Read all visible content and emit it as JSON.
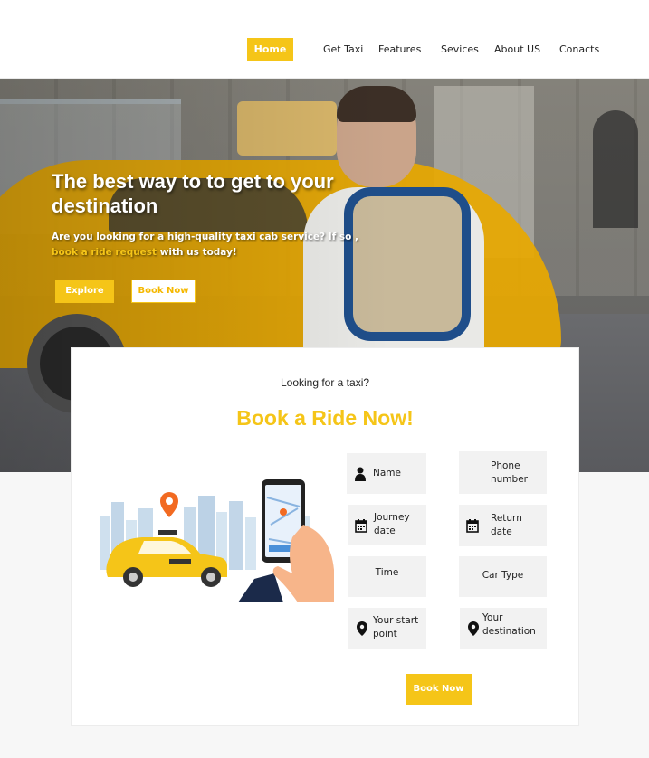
{
  "nav": {
    "items": [
      {
        "label": "Home",
        "active": true
      },
      {
        "label": "Get Taxi"
      },
      {
        "label": "Features"
      },
      {
        "label": "Sevices"
      },
      {
        "label": "About US"
      },
      {
        "label": "Conacts"
      }
    ]
  },
  "hero": {
    "title": "The best way to to get to your destination",
    "subtitle_part1": "Are you looking for a high-quality taxi cab service? If so ,",
    "subtitle_highlight": "book a ride request",
    "subtitle_part2": " with us today!",
    "explore_label": "Explore",
    "book_label": "Book Now"
  },
  "booking": {
    "kicker": "Looking for a taxi?",
    "title": "Book a Ride Now!",
    "fields": {
      "name": "Name",
      "phone": "Phone number",
      "journey_date": "Journey date",
      "return_date": "Return date",
      "time": "Time",
      "car_type": "Car Type",
      "start_point": "Your start point",
      "destination": "Your destination"
    },
    "submit_label": "Book Now"
  },
  "colors": {
    "accent": "#f5c518",
    "field_bg": "#f2f2f2",
    "pin": "#f26a21"
  },
  "icons": {
    "name": "person-icon",
    "journey_date": "calendar-icon",
    "return_date": "calendar-icon",
    "start_point": "map-pin-icon",
    "destination": "map-pin-icon"
  }
}
